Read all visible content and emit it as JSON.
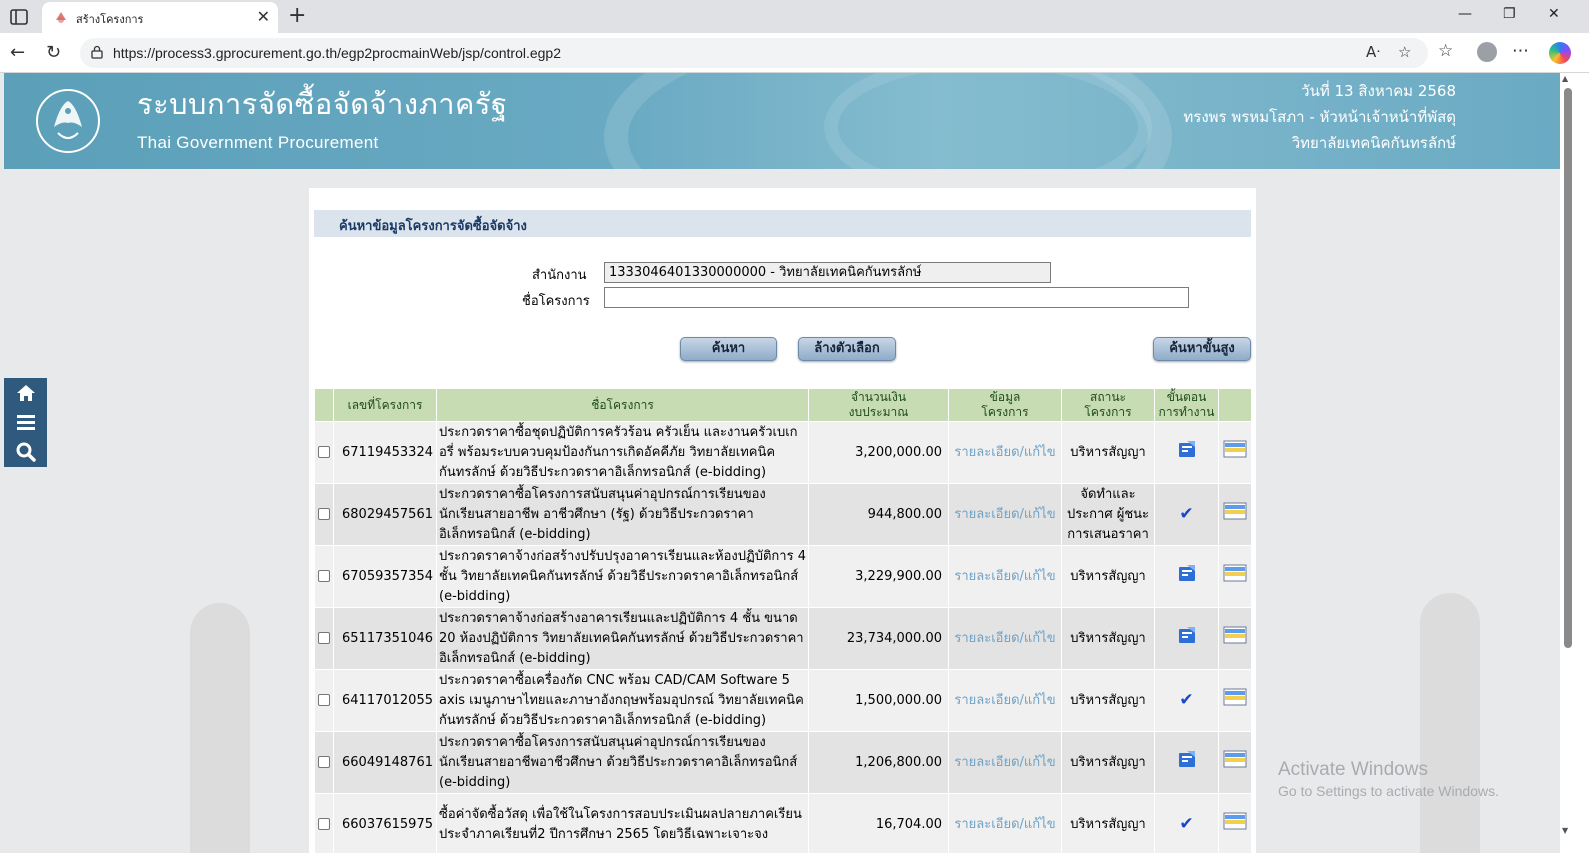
{
  "browser": {
    "tab_title": "สร้างโครงการ",
    "url": "https://process3.gprocurement.go.th/egp2procmainWeb/jsp/control.egp2"
  },
  "header": {
    "title": "ระบบการจัดซื้อจัดจ้างภาครัฐ",
    "subtitle": "Thai Government Procurement",
    "date": "วันที่ 13 สิงหาคม 2568",
    "user": "ทรงพร พรหมโสภา - หัวหน้าเจ้าหน้าที่พัสดุ",
    "agency": "วิทยาลัยเทคนิคกันทรลักษ์"
  },
  "search": {
    "title": "ค้นหาข้อมูลโครงการจัดซื้อจัดจ้าง",
    "office_label": "สำนักงาน",
    "office_value": "1333046401330000000 - วิทยาลัยเทคนิคกันทรลักษ์",
    "project_label": "ชื่อโครงการ",
    "project_value": "",
    "search_button": "ค้นหา",
    "clear_button": "ล้างตัวเลือก",
    "advanced_button": "ค้นหาขั้นสูง"
  },
  "table": {
    "headers": {
      "project_no": "เลขที่โครงการ",
      "project_name": "ชื่อโครงการ",
      "budget_1": "จำนวนเงิน",
      "budget_2": "งบประมาณ",
      "info_1": "ข้อมูล",
      "info_2": "โครงการ",
      "status_1": "สถานะ",
      "status_2": "โครงการ",
      "step_1": "ขั้นตอน",
      "step_2": "การทำงาน"
    },
    "rows": [
      {
        "no": "67119453324",
        "name": "ประกวดราคาซื้อชุดปฏิบัติการครัวร้อน ครัวเย็น และงานครัวเบเกอรี่ พร้อมระบบควบคุมป้องกันการเกิดอัคคีภัย วิทยาลัยเทคนิคกันทรลักษ์ ด้วยวิธีประกวดราคาอิเล็กทรอนิกส์ (e-bidding)",
        "amount": "3,200,000.00",
        "link": "รายละเอียด/แก้ไข",
        "status": "บริหารสัญญา",
        "step_icon": "contract-icon"
      },
      {
        "no": "68029457561",
        "name": "ประกวดราคาซื้อโครงการสนับสนุนค่าอุปกรณ์การเรียนของนักเรียนสายอาชีพ อาชีวศึกษา (รัฐ) ด้วยวิธีประกวดราคาอิเล็กทรอนิกส์ (e-bidding)",
        "amount": "944,800.00",
        "link": "รายละเอียด/แก้ไข",
        "status": "จัดทำและประกาศ ผู้ชนะการเสนอราคา",
        "step_icon": "check-icon"
      },
      {
        "no": "67059357354",
        "name": "ประกวดราคาจ้างก่อสร้างปรับปรุงอาคารเรียนและห้องปฏิบัติการ 4 ชั้น วิทยาลัยเทคนิคกันทรลักษ์ ด้วยวิธีประกวดราคาอิเล็กทรอนิกส์ (e-bidding)",
        "amount": "3,229,900.00",
        "link": "รายละเอียด/แก้ไข",
        "status": "บริหารสัญญา",
        "step_icon": "contract-icon"
      },
      {
        "no": "65117351046",
        "name": "ประกวดราคาจ้างก่อสร้างอาคารเรียนและปฏิบัติการ 4 ชั้น ขนาด 20 ห้องปฏิบัติการ วิทยาลัยเทคนิคกันทรลักษ์ ด้วยวิธีประกวดราคาอิเล็กทรอนิกส์ (e-bidding)",
        "amount": "23,734,000.00",
        "link": "รายละเอียด/แก้ไข",
        "status": "บริหารสัญญา",
        "step_icon": "contract-icon"
      },
      {
        "no": "64117012055",
        "name": "ประกวดราคาซื้อเครื่องกัด CNC พร้อม CAD/CAM Software 5 axis เมนูภาษาไทยและภาษาอังกฤษพร้อมอุปกรณ์ วิทยาลัยเทคนิคกันทรลักษ์ ด้วยวิธีประกวดราคาอิเล็กทรอนิกส์ (e-bidding)",
        "amount": "1,500,000.00",
        "link": "รายละเอียด/แก้ไข",
        "status": "บริหารสัญญา",
        "step_icon": "check-icon"
      },
      {
        "no": "66049148761",
        "name": "ประกวดราคาซื้อโครงการสนับสนุนค่าอุปกรณ์การเรียนของนักเรียนสายอาชีพอาชีวศึกษา ด้วยวิธีประกวดราคาอิเล็กทรอนิกส์ (e-bidding)",
        "amount": "1,206,800.00",
        "link": "รายละเอียด/แก้ไข",
        "status": "บริหารสัญญา",
        "step_icon": "contract-icon"
      },
      {
        "no": "66037615975",
        "name": "ซื้อค่าจัดซื้อวัสดุ เพื่อใช้ในโครงการสอบประเมินผลปลายภาคเรียน ประจำภาคเรียนที่2 ปีการศึกษา 2565 โดยวิธีเฉพาะเจาะจง",
        "amount": "16,704.00",
        "link": "รายละเอียด/แก้ไข",
        "status": "บริหารสัญญา",
        "step_icon": "check-icon"
      }
    ]
  },
  "watermark": {
    "line1": "Activate Windows",
    "line2": "Go to Settings to activate Windows."
  }
}
